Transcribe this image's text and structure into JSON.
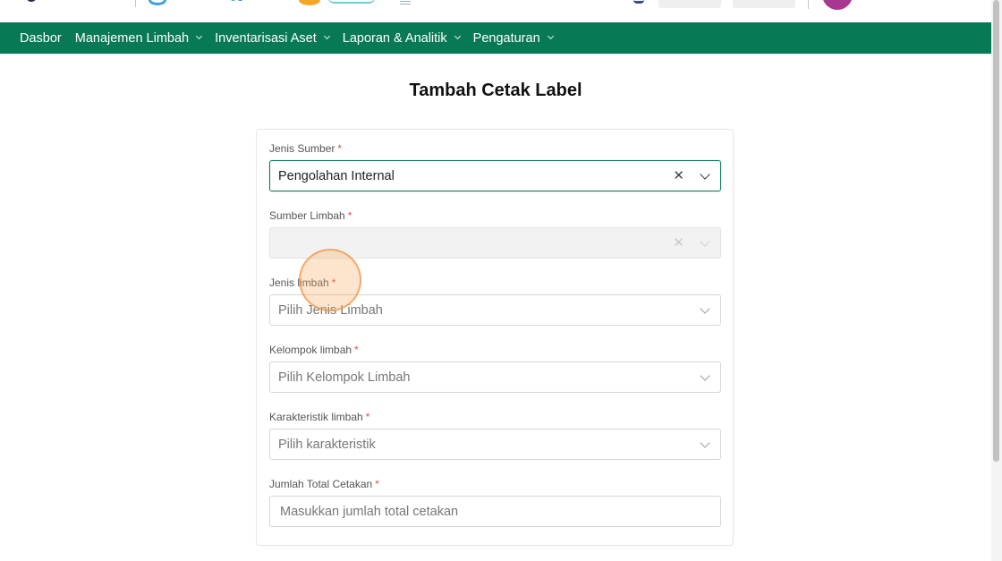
{
  "nav": {
    "items": [
      {
        "label": "Dasbor",
        "has_dropdown": false
      },
      {
        "label": "Manajemen Limbah",
        "has_dropdown": true
      },
      {
        "label": "Inventarisasi Aset",
        "has_dropdown": true
      },
      {
        "label": "Laporan & Analitik",
        "has_dropdown": true
      },
      {
        "label": "Pengaturan",
        "has_dropdown": true
      }
    ],
    "background": "#077a55"
  },
  "page": {
    "title": "Tambah Cetak Label"
  },
  "form": {
    "required_marker": "*",
    "jenis_sumber": {
      "label": "Jenis Sumber",
      "value": "Pengolahan Internal"
    },
    "sumber_limbah": {
      "label": "Sumber Limbah",
      "value": ""
    },
    "jenis_limbah": {
      "label": "Jenis limbah",
      "placeholder": "Pilih Jenis Limbah"
    },
    "kelompok_limbah": {
      "label": "Kelompok limbah",
      "placeholder": "Pilih Kelompok Limbah"
    },
    "karakteristik_limbah": {
      "label": "Karakteristik limbah",
      "placeholder": "Pilih karakteristik"
    },
    "jumlah_total": {
      "label": "Jumlah Total Cetakan",
      "placeholder": "Masukkan jumlah total cetakan"
    }
  },
  "icons": {
    "clear": "✕",
    "dropdown": "chevron-down-icon"
  },
  "colors": {
    "accent": "#077a55",
    "required": "#d9534f",
    "avatar": "#a8388f"
  }
}
